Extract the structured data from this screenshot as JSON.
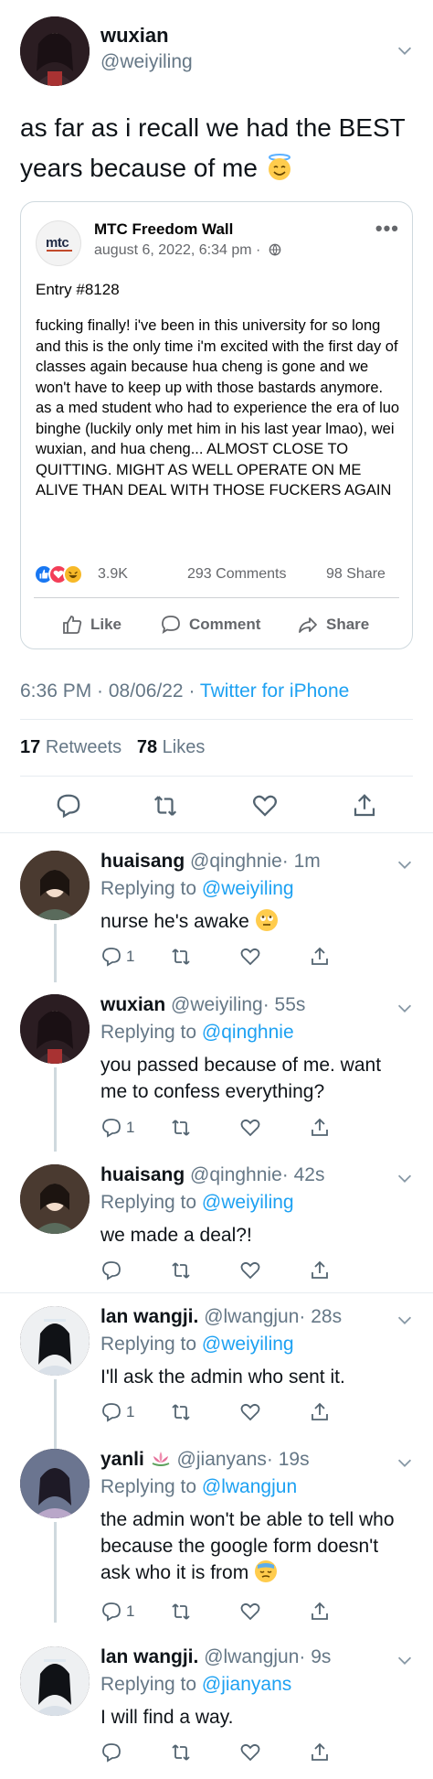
{
  "main_tweet": {
    "author_name": "wuxian",
    "author_handle": "@weiyiling",
    "text": "as far as i recall we had the BEST years because of me",
    "text_emoji": "smiling-face-with-halo",
    "timestamp": "6:36 PM · 08/06/22 · ",
    "source": "Twitter for iPhone",
    "retweets_count": "17",
    "retweets_label": "Retweets",
    "likes_count": "78",
    "likes_label": "Likes"
  },
  "fb_post": {
    "page_name": "MTC Freedom Wall",
    "logo_text": "mtc",
    "date": "august 6, 2022, 6:34 pm ·",
    "entry": "Entry #8128",
    "body": "fucking finally! i've been in this university for so long and this is the only time i'm excited with the first day of classes again because hua cheng is gone and we won't have to keep up with those bastards anymore. as a med student who had to experience the era of luo binghe (luckily only met him in his last year lmao), wei wuxian, and hua cheng... ALMOST CLOSE TO QUITTING. MIGHT AS WELL OPERATE ON ME ALIVE THAN DEAL WITH THOSE FUCKERS AGAIN",
    "reactions_count": "3.9K",
    "comments": "293 Comments",
    "shares": "98 Share",
    "actions": {
      "like": "Like",
      "comment": "Comment",
      "share": "Share"
    }
  },
  "replies": [
    {
      "name": "huaisang",
      "handle": "@qinghnie",
      "time": "· 1m",
      "replying_label": "Replying to",
      "replying_to": "@weiyiling",
      "text": "nurse he's awake",
      "emoji": "face-with-rolling-eyes",
      "reply_count": "1"
    },
    {
      "name": "wuxian",
      "handle": "@weiyiling",
      "time": "· 55s",
      "replying_label": "Replying to",
      "replying_to": "@qinghnie",
      "text": "you passed because of me. want me to confess everything?",
      "reply_count": "1"
    },
    {
      "name": "huaisang",
      "handle": "@qinghnie",
      "time": "· 42s",
      "replying_label": "Replying to",
      "replying_to": "@weiyiling",
      "text": "we made a deal?!",
      "reply_count": ""
    },
    {
      "name": "lan wangji.",
      "handle": "@lwangjun",
      "time": "· 28s",
      "replying_label": "Replying to",
      "replying_to": "@weiyiling",
      "text": "I'll ask the admin who sent it.",
      "reply_count": "1"
    },
    {
      "name": "yanli",
      "name_emoji": "lotus",
      "handle": "@jianyans",
      "time": "· 19s",
      "replying_label": "Replying to",
      "replying_to": "@lwangjun",
      "text": "the admin won't be able to tell who because the google form doesn't ask who it is from",
      "emoji": "downcast-face-with-sweat",
      "reply_count": "1"
    },
    {
      "name": "lan wangji.",
      "handle": "@lwangjun",
      "time": "· 9s",
      "replying_label": "Replying to",
      "replying_to": "@jianyans",
      "text": "I will find a way.",
      "reply_count": ""
    }
  ],
  "colors": {
    "link": "#1da1f2",
    "secondary": "#657786",
    "fb_blue": "#1877f2"
  }
}
